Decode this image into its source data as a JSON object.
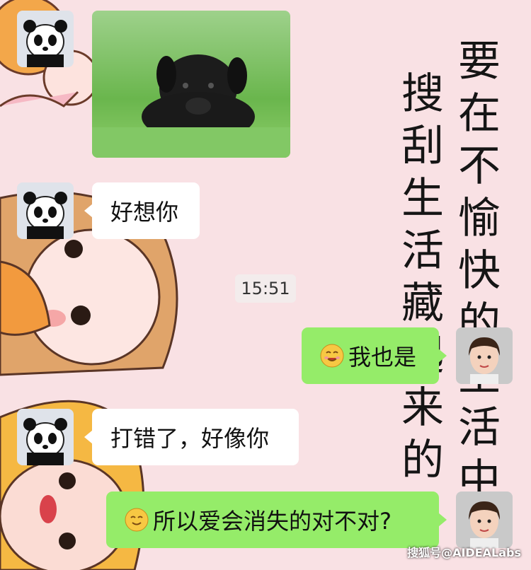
{
  "wallpaper": {
    "column_right": "要在不愉快的生活中",
    "column_left": "搜刮生活藏起来的"
  },
  "chat": {
    "time_divider": "15:51",
    "messages": [
      {
        "side": "left",
        "type": "image",
        "alt": "black puppy on grass"
      },
      {
        "side": "left",
        "type": "text",
        "text": "好想你"
      },
      {
        "side": "right",
        "type": "text",
        "text": "我也是"
      },
      {
        "side": "left",
        "type": "text",
        "text": "打错了，好像你"
      },
      {
        "side": "right",
        "type": "text",
        "text": "所以爱会消失的对不对?"
      }
    ]
  },
  "watermark": "搜狐号@AIDEALabs",
  "colors": {
    "sent_bubble": "#95ec69",
    "received_bubble": "#ffffff",
    "background": "#f9e1e4"
  },
  "icons": {
    "panda_avatar": "panda-avatar-icon",
    "girl_avatar": "girl-avatar-icon",
    "emoji": "smiling-face-icon"
  }
}
